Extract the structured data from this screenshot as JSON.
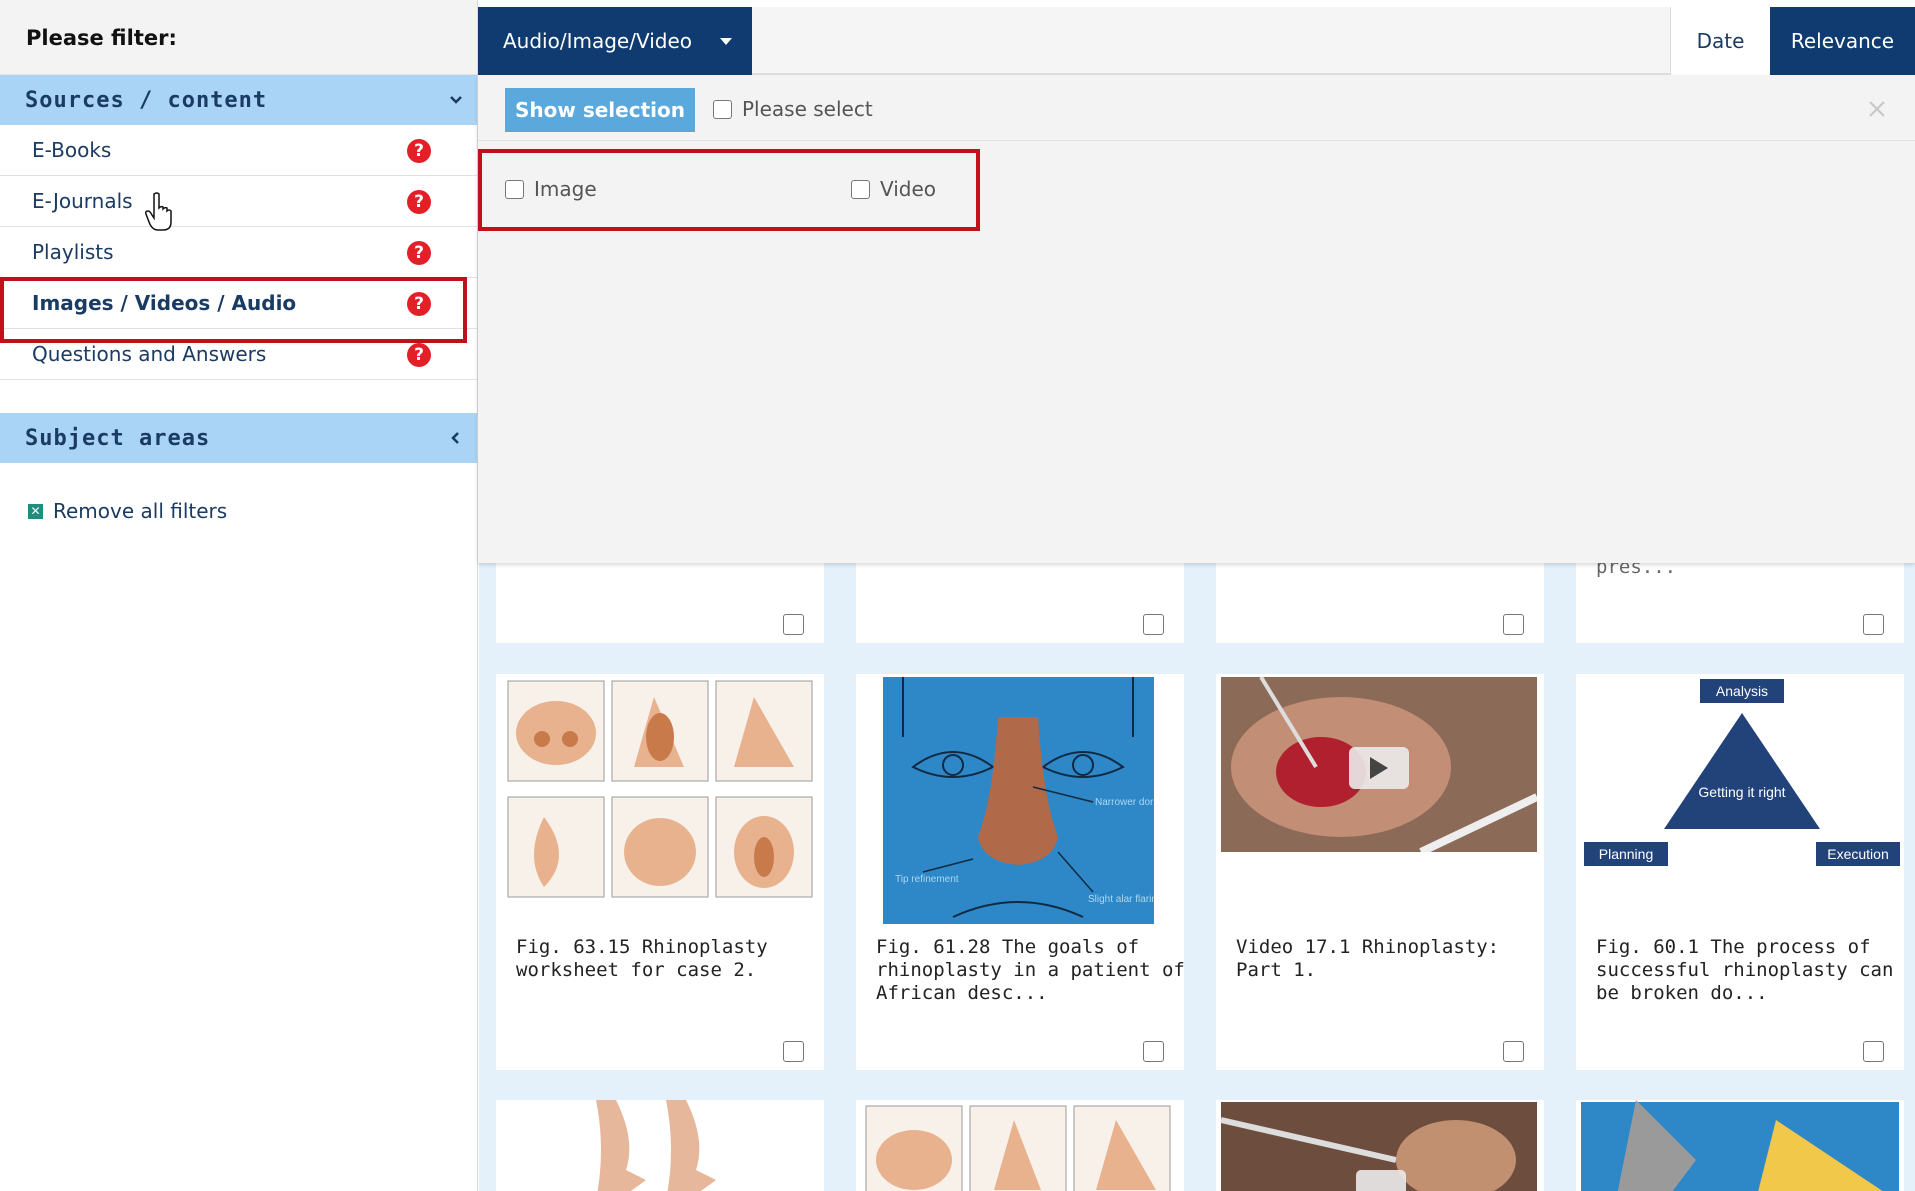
{
  "sidebar": {
    "heading": "Please filter:",
    "sources_section": "Sources / content",
    "items": [
      {
        "label": "E-Books"
      },
      {
        "label": "E-Journals"
      },
      {
        "label": "Playlists"
      },
      {
        "label": "Images / Videos / Audio"
      },
      {
        "label": "Questions and Answers"
      }
    ],
    "help_glyph": "?",
    "subject_section": "Subject areas",
    "remove_filters": "Remove all filters"
  },
  "topbar": {
    "type_dropdown": "Audio/Image/Video",
    "sort_date": "Date",
    "sort_relevance": "Relevance"
  },
  "panel": {
    "show_selection": "Show selection",
    "please_select": "Please select",
    "options": [
      {
        "label": "Image"
      },
      {
        "label": "Video"
      }
    ]
  },
  "results": {
    "peek_text": "pres...",
    "cards": [
      {
        "caption": "Fig. 63.15 Rhinoplasty worksheet for case 2."
      },
      {
        "caption": "Fig. 61.28 The goals of rhinoplasty in a patient of African desc...",
        "labels": [
          "Narrower dorsum",
          "Tip refinement",
          "Slight alar flaring"
        ]
      },
      {
        "caption": "Video 17.1 Rhinoplasty: Part 1."
      },
      {
        "caption": "Fig. 60.1 The process of successful rhinoplasty can be broken do...",
        "labels": [
          "Analysis",
          "Getting it right",
          "Planning",
          "Execution"
        ]
      }
    ]
  },
  "colors": {
    "navy": "#0f3b71",
    "accordion": "#a9d4f5",
    "highlight": "#c0101b",
    "help": "#e32028",
    "button": "#5ba9dc",
    "grid": "#e4f1fb"
  }
}
